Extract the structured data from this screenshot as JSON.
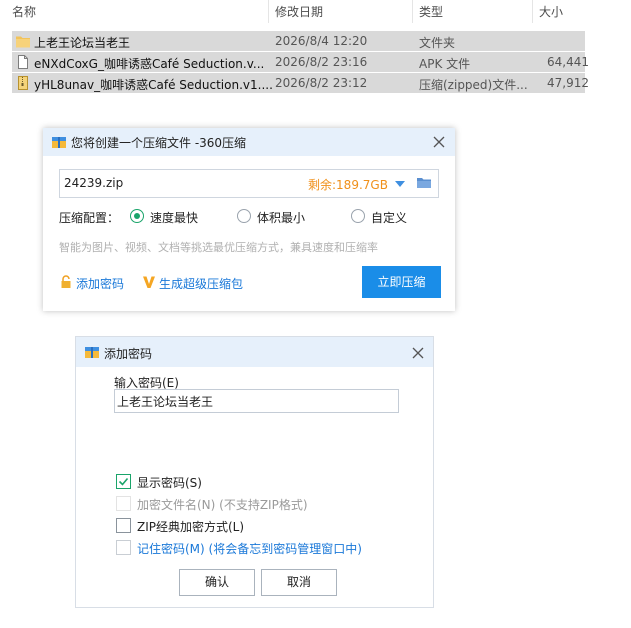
{
  "file_list": {
    "columns": [
      "名称",
      "修改日期",
      "类型",
      "大小"
    ],
    "rows": [
      {
        "name": "上老王论坛当老王",
        "date": "2026/8/4 12:20",
        "type": "文件夹",
        "size": "",
        "icon": "folder-icon"
      },
      {
        "name": "eNXdCoxG_咖啡诱惑Café Seduction.v...",
        "date": "2026/8/2 23:16",
        "type": "APK 文件",
        "size": "64,441",
        "icon": "file-icon"
      },
      {
        "name": "yHL8unav_咖啡诱惑Café Seduction.v1....",
        "date": "2026/8/2 23:12",
        "type": "压缩(zipped)文件...",
        "size": "47,912",
        "icon": "zip-file-icon"
      }
    ]
  },
  "dialog_360": {
    "title": "您将创建一个压缩文件 -360压缩",
    "filename": "24239.zip",
    "free_space": "剩余:189.7GB",
    "config_label": "压缩配置：",
    "options": [
      "速度最快",
      "体积最小",
      "自定义"
    ],
    "selected_option": "速度最快",
    "hint": "智能为图片、视频、文档等挑选最优压缩方式，兼具速度和压缩率",
    "add_password_link": "添加密码",
    "super_package_link": "生成超级压缩包",
    "compress_button": "立即压缩",
    "accent_color": "#1a8de8"
  },
  "password_dialog": {
    "title": "添加密码",
    "input_label": "输入密码(E)",
    "password_value": "上老王论坛当老王",
    "options": [
      {
        "label": "显示密码(S)",
        "checked": true,
        "enabled": true
      },
      {
        "label": "加密文件名(N) (不支持ZIP格式)",
        "checked": false,
        "enabled": false
      },
      {
        "label": "ZIP经典加密方式(L)",
        "checked": false,
        "enabled": true
      },
      {
        "label": "记住密码(M) (将会备忘到密码管理窗口中)",
        "checked": false,
        "enabled": true
      }
    ],
    "ok_button": "确认",
    "cancel_button": "取消"
  }
}
